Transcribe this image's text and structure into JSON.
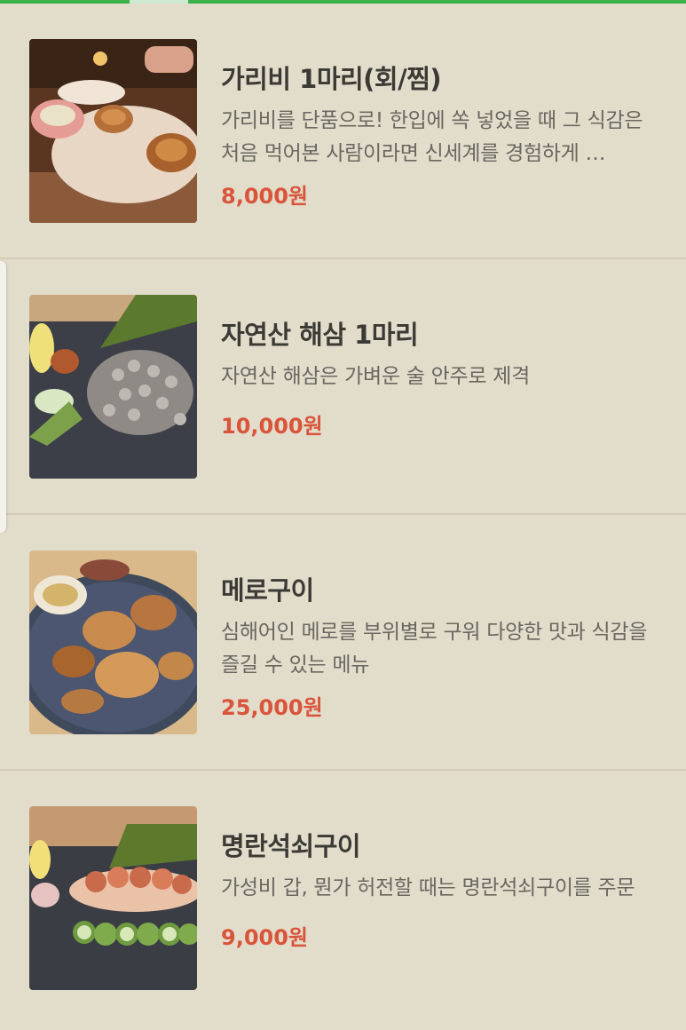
{
  "menu": {
    "items": [
      {
        "name": "가리비 1마리(회/찜)",
        "description": "가리비를 단품으로! 한입에 쏙 넣었을 때 그 식감은 처음 먹어본 사람이라면 신세계를 경험하게 …",
        "price": "8,000원",
        "image_icon": "scallop-dish-photo"
      },
      {
        "name": "자연산 해삼 1마리",
        "description": "자연산 해삼은 가벼운 술 안주로 제격",
        "price": "10,000원",
        "image_icon": "sea-cucumber-dish-photo"
      },
      {
        "name": "메로구이",
        "description": "심해어인 메로를 부위별로 구워 다양한 맛과 식감을 즐길 수 있는 메뉴",
        "price": "25,000원",
        "image_icon": "grilled-toothfish-photo"
      },
      {
        "name": "명란석쇠구이",
        "description": "가성비 갑, 뭔가 허전할 때는 명란석쇠구이를 주문",
        "price": "9,000원",
        "image_icon": "grilled-pollock-roe-photo"
      }
    ]
  },
  "colors": {
    "background": "#e2dccb",
    "accent_bar": "#3bb14a",
    "price": "#d9543a",
    "title": "#3b3a35",
    "description": "#696760"
  }
}
